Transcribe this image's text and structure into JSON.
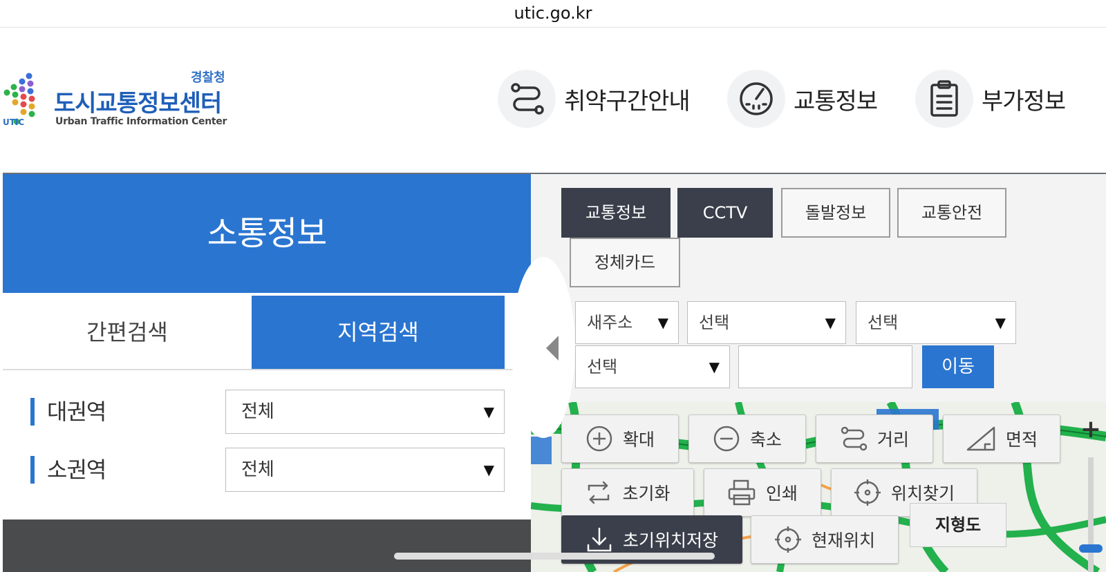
{
  "browser": {
    "url": "utic.go.kr"
  },
  "logo": {
    "agency": "경찰청",
    "title": "도시교통정보센터",
    "subtitle": "Urban Traffic Information Center",
    "abbr": "UTIC"
  },
  "topnav": [
    {
      "label": "취약구간안내",
      "icon": "route-icon"
    },
    {
      "label": "교통정보",
      "icon": "speedometer-icon"
    },
    {
      "label": "부가정보",
      "icon": "clipboard-icon"
    }
  ],
  "left_panel": {
    "title": "소통정보",
    "subtabs": [
      {
        "label": "간편검색",
        "active": false
      },
      {
        "label": "지역검색",
        "active": true
      }
    ],
    "fields": [
      {
        "label": "대권역",
        "value": "전체"
      },
      {
        "label": "소권역",
        "value": "전체"
      }
    ]
  },
  "right_panel": {
    "tabs": [
      {
        "label": "교통정보",
        "active": true
      },
      {
        "label": "CCTV",
        "active": true
      },
      {
        "label": "돌발정보",
        "active": false
      },
      {
        "label": "교통안전",
        "active": false
      },
      {
        "label": "정체카드",
        "active": false
      }
    ],
    "address": {
      "type_value": "새주소",
      "sido_value": "선택",
      "sigungu_value": "선택",
      "road_value": "선택",
      "search_value": "",
      "move_label": "이동"
    }
  },
  "map_tools": {
    "zoom_in": "확대",
    "zoom_out": "축소",
    "distance": "거리",
    "area": "면적",
    "reset": "초기화",
    "print": "인쇄",
    "find_location": "위치찾기",
    "save_initial": "초기위치저장",
    "current_location": "현재위치",
    "terrain": "지형도",
    "zoom_plus": "+"
  },
  "colors": {
    "primary_blue": "#2a75d0",
    "dark_tab": "#3a3f4b",
    "road_green": "#22b14c"
  }
}
